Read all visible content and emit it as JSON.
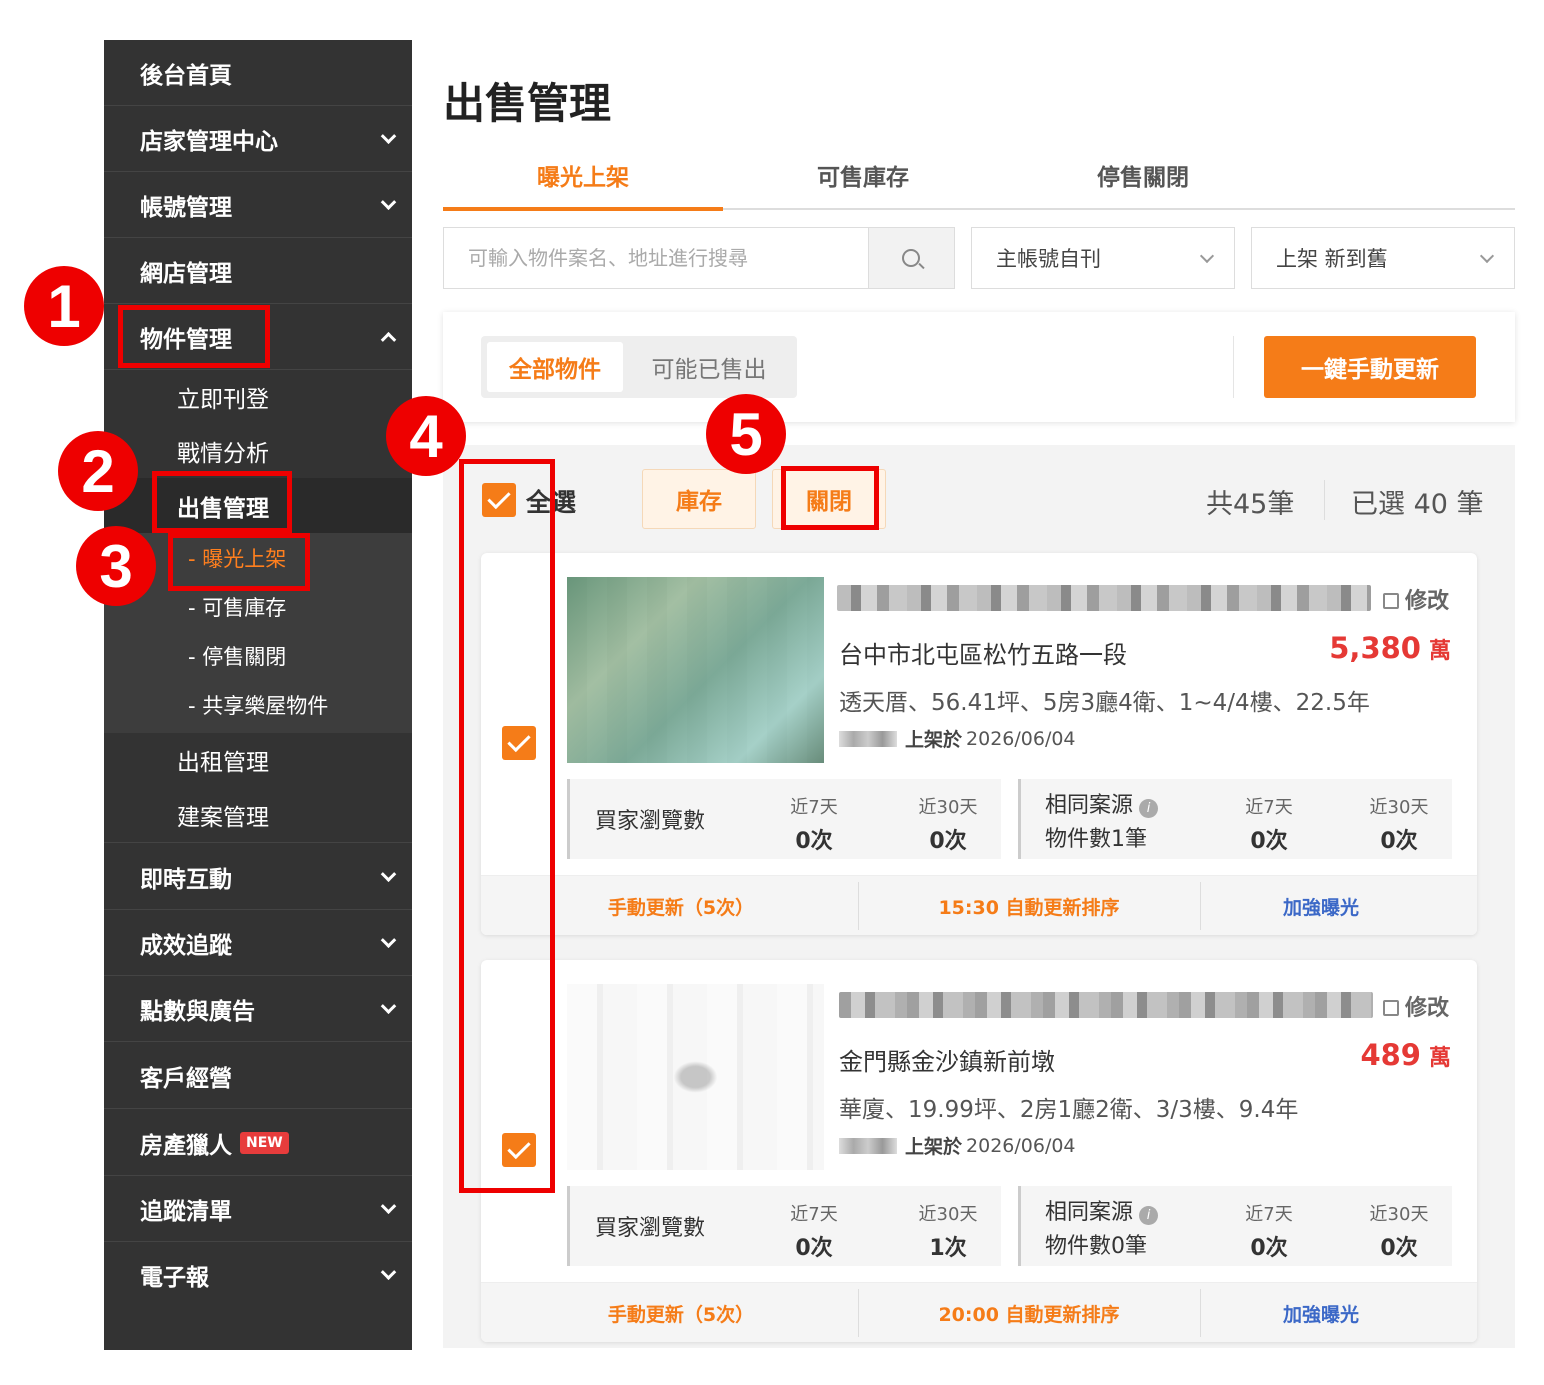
{
  "sidebar": {
    "home": "後台首頁",
    "store_center": "店家管理中心",
    "account": "帳號管理",
    "shop": "網店管理",
    "property": "物件管理",
    "post_now": "立即刊登",
    "analytics": "戰情分析",
    "sale_mgmt": "出售管理",
    "sub_exposed": "- 曝光上架",
    "sub_inventory": "- 可售庫存",
    "sub_closed": "- 停售關閉",
    "sub_shared": "- 共享樂屋物件",
    "rent_mgmt": "出租管理",
    "project_mgmt": "建案管理",
    "interaction": "即時互動",
    "performance": "成效追蹤",
    "points_ads": "點數與廣告",
    "customers": "客戶經營",
    "hunter": "房產獵人",
    "new_badge": "NEW",
    "tracking": "追蹤清單",
    "newsletter": "電子報"
  },
  "page": {
    "title": "出售管理",
    "tabs": [
      "曝光上架",
      "可售庫存",
      "停售關閉"
    ]
  },
  "search": {
    "placeholder": "可輸入物件案名、地址進行搜尋"
  },
  "filters": {
    "account": "主帳號自刊",
    "sort": "上架 新到舊"
  },
  "segment": {
    "all": "全部物件",
    "maybe_sold": "可能已售出"
  },
  "refresh_all": "一鍵手動更新",
  "bulk": {
    "select_all": "全選",
    "inventory": "庫存",
    "close": "關閉",
    "total": "共45筆",
    "selected": "已選 40 筆"
  },
  "listings": [
    {
      "edit": "修改",
      "address": "台中市北屯區松竹五路一段",
      "price": "5,380",
      "price_unit": "萬",
      "spec": "透天厝、56.41坪、5房3廳4衛、1~4/4樓、22.5年",
      "posted_label": "上架於",
      "posted_date": "2026/06/04",
      "views_label": "買家瀏覽數",
      "same_label_1": "相同案源",
      "same_label_2": "物件數1筆",
      "k7": "近7天",
      "k30": "近30天",
      "views_7": "0次",
      "views_30": "0次",
      "same_7": "0次",
      "same_30": "0次",
      "act_manual": "手動更新（5次）",
      "act_auto": "15:30 自動更新排序",
      "act_boost": "加強曝光"
    },
    {
      "edit": "修改",
      "address": "金門縣金沙鎮新前墩",
      "price": "489",
      "price_unit": "萬",
      "spec": "華廈、19.99坪、2房1廳2衛、3/3樓、9.4年",
      "posted_label": "上架於",
      "posted_date": "2026/06/04",
      "views_label": "買家瀏覽數",
      "same_label_1": "相同案源",
      "same_label_2": "物件數0筆",
      "k7": "近7天",
      "k30": "近30天",
      "views_7": "0次",
      "views_30": "1次",
      "same_7": "0次",
      "same_30": "0次",
      "act_manual": "手動更新（5次）",
      "act_auto": "20:00 自動更新排序",
      "act_boost": "加強曝光"
    }
  ],
  "annotations": [
    "1",
    "2",
    "3",
    "4",
    "5"
  ],
  "colors": {
    "accent": "#f57c18",
    "annotation": "#ee0000",
    "sidebar_bg": "#333333",
    "price": "#e53935"
  }
}
